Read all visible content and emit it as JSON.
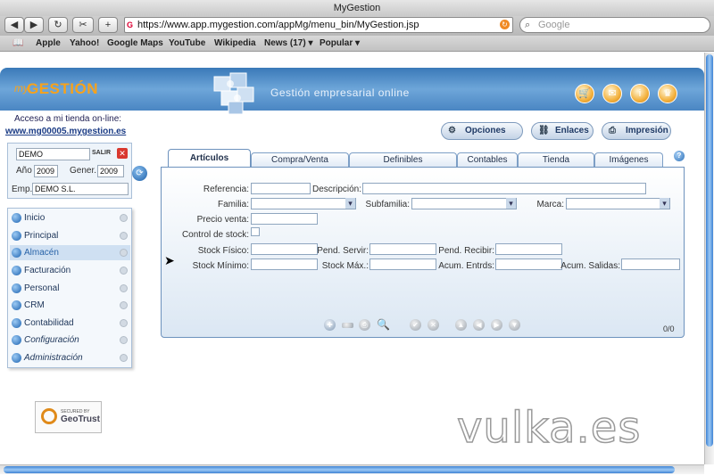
{
  "browser": {
    "window_title": "MyGestion",
    "back_label": "◀",
    "forward_label": "▶",
    "reload_label": "↻",
    "add_label": "+",
    "url": "https://www.app.mygestion.com/appMg/menu_bin/MyGestion.jsp",
    "search_placeholder": "Google",
    "bookmarks": [
      "Apple",
      "Yahoo!",
      "Google Maps",
      "YouTube",
      "Wikipedia",
      "News (17)",
      "Popular"
    ]
  },
  "header": {
    "logo_prefix": "my",
    "logo_main": "GESTIÓN",
    "tagline": "Gestión empresarial online",
    "icons": [
      "cart-icon",
      "mail-icon",
      "info-icon",
      "trophy-icon"
    ]
  },
  "shop": {
    "label": "Acceso a mi tienda on-line:",
    "link": "www.mg00005.mygestion.es"
  },
  "actions": {
    "opciones": "Opciones",
    "enlaces": "Enlaces",
    "impresion": "Impresión"
  },
  "login": {
    "user": "DEMO",
    "salir": "SALIR",
    "ano_label": "Año",
    "ano": "2009",
    "gener_label": "Gener.",
    "gener": "2009",
    "emp_label": "Emp.",
    "emp": "DEMO S.L."
  },
  "menu": {
    "items": [
      {
        "label": "Inicio"
      },
      {
        "label": "Principal"
      },
      {
        "label": "Almacén"
      },
      {
        "label": "Facturación"
      },
      {
        "label": "Personal"
      },
      {
        "label": "CRM"
      },
      {
        "label": "Contabilidad"
      },
      {
        "label": "Configuración"
      },
      {
        "label": "Administración"
      }
    ]
  },
  "geotrust": {
    "line1": "SECURED BY",
    "line2": "GeoTrust"
  },
  "tabs": [
    "Artículos",
    "Compra/Venta",
    "Definibles",
    "Contables",
    "Tienda",
    "Imágenes"
  ],
  "form": {
    "referencia": "Referencia:",
    "descripcion": "Descripción:",
    "familia": "Familia:",
    "subfamilia": "Subfamilia:",
    "marca": "Marca:",
    "precio_venta": "Precio venta:",
    "control_stock": "Control de stock:",
    "stock_fisico": "Stock Físico:",
    "pend_servir": "Pend. Servir:",
    "pend_recibir": "Pend. Recibir:",
    "stock_minimo": "Stock Mínimo:",
    "stock_max": "Stock Máx.:",
    "acum_entrds": "Acum. Entrds:",
    "acum_salidas": "Acum. Salidas:"
  },
  "pager": "0/0",
  "watermark": "vulka.es"
}
